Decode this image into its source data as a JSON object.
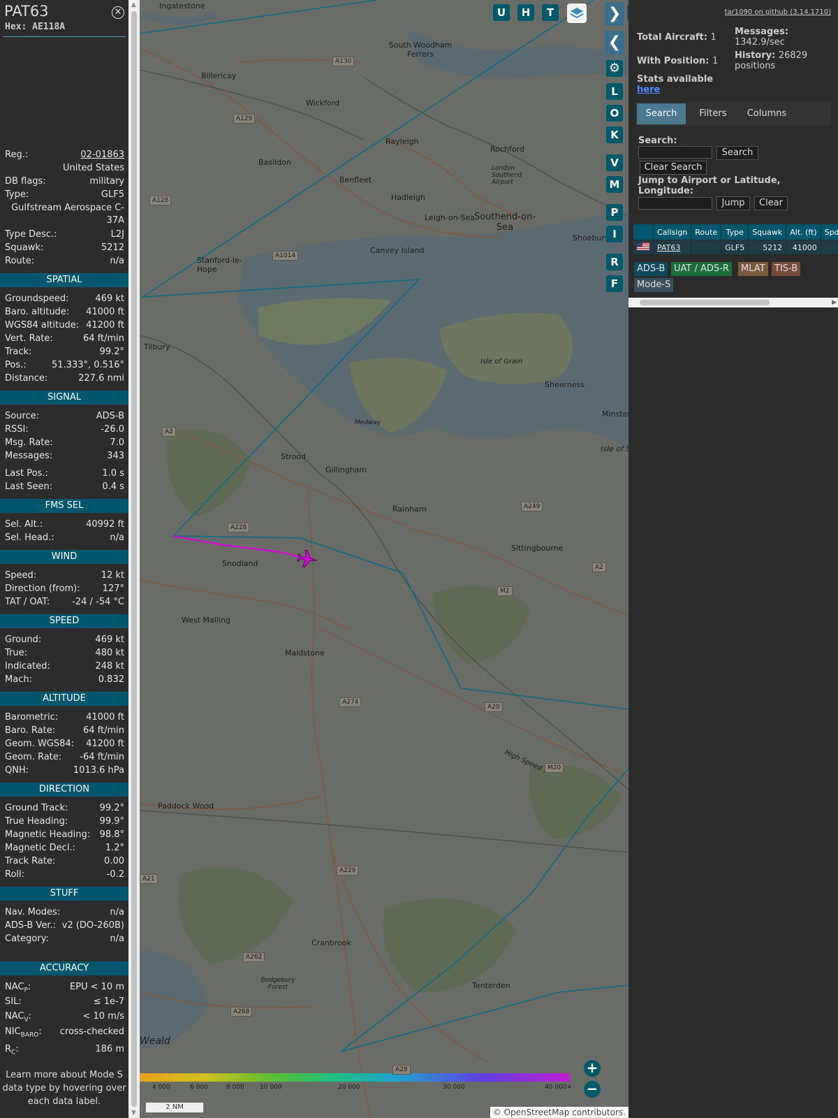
{
  "aircraft": {
    "callsign": "PAT63",
    "hex_label": "Hex: AE118A",
    "close_icon": "close-icon",
    "footnote": "Learn more about Mode S data type by hovering over each data label."
  },
  "info": {
    "reg_label": "Reg.:",
    "reg": "02-01863",
    "country": "United States",
    "dbflags_label": "DB flags:",
    "dbflags": "military",
    "type_label": "Type:",
    "type": "GLF5",
    "type_full": "Gulfstream Aerospace C-37A",
    "typedesc_label": "Type Desc.:",
    "typedesc": "L2J",
    "squawk_label": "Squawk:",
    "squawk": "5212",
    "route_label": "Route:",
    "route": "n/a"
  },
  "sections": {
    "spatial": "SPATIAL",
    "signal": "SIGNAL",
    "fms": "FMS SEL",
    "wind": "WIND",
    "speed": "SPEED",
    "altitude": "ALTITUDE",
    "direction": "DIRECTION",
    "stuff": "STUFF",
    "accuracy": "ACCURACY"
  },
  "spatial": {
    "gs_label": "Groundspeed:",
    "gs": "469 kt",
    "baro_label": "Baro. altitude:",
    "baro": "41000 ft",
    "wgs_label": "WGS84 altitude:",
    "wgs": "41200 ft",
    "vr_label": "Vert. Rate:",
    "vr": "64 ft/min",
    "track_label": "Track:",
    "track": "99.2°",
    "pos_label": "Pos.:",
    "pos": "51.333°, 0.516°",
    "dist_label": "Distance:",
    "dist": "227.6 nmi"
  },
  "signal": {
    "src_label": "Source:",
    "src": "ADS-B",
    "rssi_label": "RSSI:",
    "rssi": "-26.0",
    "msgrate_label": "Msg. Rate:",
    "msgrate": "7.0",
    "messages_label": "Messages:",
    "messages": "343",
    "lastpos_label": "Last Pos.:",
    "lastpos": "1.0 s",
    "lastseen_label": "Last Seen:",
    "lastseen": "0.4 s"
  },
  "fms": {
    "selalt_label": "Sel. Alt.:",
    "selalt": "40992 ft",
    "selhead_label": "Sel. Head.:",
    "selhead": "n/a"
  },
  "wind": {
    "speed_label": "Speed:",
    "speed": "12 kt",
    "dir_label": "Direction (from):",
    "dir": "127°",
    "tat_label": "TAT / OAT:",
    "tat": "-24 / -54 °C"
  },
  "speed": {
    "ground_label": "Ground:",
    "ground": "469 kt",
    "true_label": "True:",
    "true": "480 kt",
    "ind_label": "Indicated:",
    "ind": "248 kt",
    "mach_label": "Mach:",
    "mach": "0.832"
  },
  "altitude": {
    "baro_label": "Barometric:",
    "baro": "41000 ft",
    "barorate_label": "Baro. Rate:",
    "barorate": "64 ft/min",
    "geom_label": "Geom. WGS84:",
    "geom": "41200 ft",
    "geomrate_label": "Geom. Rate:",
    "geomrate": "-64 ft/min",
    "qnh_label": "QNH:",
    "qnh": "1013.6 hPa"
  },
  "direction": {
    "gt_label": "Ground Track:",
    "gt": "99.2°",
    "th_label": "True Heading:",
    "th": "99.9°",
    "mh_label": "Magnetic Heading:",
    "mh": "98.8°",
    "md_label": "Magnetic Decl.:",
    "md": "1.2°",
    "tr_label": "Track Rate:",
    "tr": "0.00",
    "roll_label": "Roll:",
    "roll": "-0.2"
  },
  "stuff": {
    "nav_label": "Nav. Modes:",
    "nav": "n/a",
    "adsbver_label": "ADS-B Ver.:",
    "adsbver": "v2 (DO-260B)",
    "cat_label": "Category:",
    "cat": "n/a"
  },
  "accuracy": {
    "nacp_main": "NAC",
    "nacp_sub": "P",
    "nacp": "EPU < 10 m",
    "sil_label": "SIL:",
    "sil": "≤ 1e-7",
    "nacv_main": "NAC",
    "nacv_sub": "V",
    "nacv": "< 10 m/s",
    "nicbaro_main": "NIC",
    "nicbaro_sub": "BARO",
    "nicbaro": "cross-checked",
    "rc_main": "R",
    "rc_sub": "C",
    "rc": "186 m"
  },
  "map": {
    "top_buttons": [
      "U",
      "H",
      "T"
    ],
    "side_buttons": [
      "L",
      "O",
      "K",
      "V",
      "M",
      "P",
      "I",
      "R",
      "F"
    ],
    "scale": "2 NM",
    "attribution": "© OpenStreetMap contributors.",
    "altitude_ticks": [
      "4 000",
      "6 000",
      "8 000",
      "10 000",
      "20 000",
      "30 000",
      "40 000+"
    ],
    "places": [
      "Ingatestone",
      "South Woodham Ferrers",
      "Billericay",
      "Wickford",
      "Rayleigh",
      "Rochford",
      "Basildon",
      "Benfleet",
      "Hadleigh",
      "Leigh-on-Sea",
      "Southend-on-Sea",
      "Shoebury",
      "Canvey Island",
      "Stanford-le-Hope",
      "Tilbury",
      "Isle of Grain",
      "Sheerness",
      "Minster",
      "Isle of S",
      "Medway",
      "Strood",
      "Gillingham",
      "Rainham",
      "Sittingbourne",
      "Snodland",
      "West Malling",
      "Maidstone",
      "Paddock Wood",
      "Cranbrook",
      "Tenterden",
      "Bedgebury Forest",
      "Southend Airport",
      "London Southend Airport",
      "Weald",
      "High Speed 1"
    ],
    "roads": [
      "A130",
      "A129",
      "A128",
      "A1014",
      "A2",
      "A228",
      "A249",
      "A2",
      "M2",
      "A274",
      "A20",
      "M20",
      "A229",
      "A262",
      "A268",
      "A28",
      "A21"
    ]
  },
  "right": {
    "github": "tar1090 on github (3.14.1710)",
    "total_label": "Total Aircraft:",
    "total": "1",
    "withpos_label": "With Position:",
    "withpos": "1",
    "messages_label": "Messages:",
    "messages": "1342.9/sec",
    "history_label": "History:",
    "history": "26829",
    "history_unit": "positions",
    "stats_label": "Stats available",
    "here": "here",
    "tabs": [
      "Search",
      "Filters",
      "Columns"
    ],
    "search_label": "Search:",
    "search_button": "Search",
    "clear_search": "Clear Search",
    "jump_label": "Jump to Airport or Latitude, Longitude:",
    "jump_button": "Jump",
    "clear_button": "Clear",
    "columns": [
      "",
      "Callsign",
      "Route",
      "Type",
      "Squawk",
      "Alt. (ft)",
      "Spd."
    ],
    "row": {
      "callsign": "PAT63",
      "route": "",
      "type": "GLF5",
      "squawk": "5212",
      "alt": "41000",
      "spd": ""
    },
    "sources": [
      "ADS-B",
      "UAT / ADS-R",
      "MLAT",
      "TIS-B",
      "Mode-S"
    ]
  },
  "colors": {
    "section_bg": "#00576e",
    "accent_teal": "#00596b",
    "track_line": "#0e6e8a",
    "aircraft": "#e000e0"
  }
}
